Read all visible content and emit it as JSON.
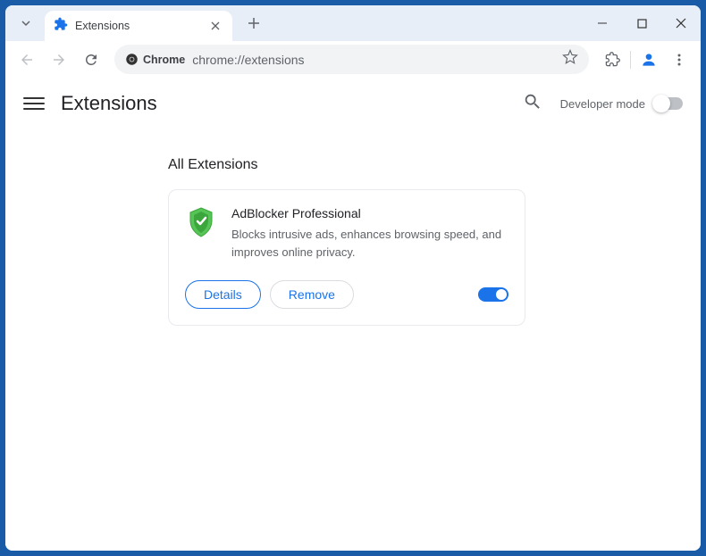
{
  "tab": {
    "title": "Extensions"
  },
  "omnibox": {
    "chip": "Chrome",
    "url": "chrome://extensions"
  },
  "page": {
    "title": "Extensions",
    "dev_mode_label": "Developer mode",
    "section_title": "All Extensions"
  },
  "extension": {
    "name": "AdBlocker Professional",
    "description": "Blocks intrusive ads, enhances browsing speed, and improves online privacy.",
    "details_label": "Details",
    "remove_label": "Remove",
    "enabled": true
  },
  "colors": {
    "accent": "#1a73e8"
  }
}
